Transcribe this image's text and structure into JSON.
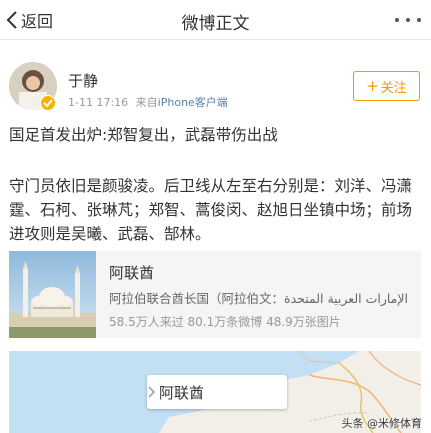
{
  "nav": {
    "back_label": "返回",
    "title": "微博正文",
    "back_icon": "chevron-left-icon",
    "more_icon": "more-dots-icon"
  },
  "user": {
    "name": "于静",
    "timestamp": "1-11 17:16",
    "source_prefix": "来自",
    "source": "iPhone客户端",
    "follow_label": "关注",
    "verified_badge_color": "#f6b400"
  },
  "post": {
    "line1": "国足首发出炉:郑智复出，武磊带伤出战",
    "line2": "守门员依旧是颜骏凌。后卫线从左至右分别是：刘洋、冯潇霆、石柯、张琳芃；郑智、蒿俊闵、赵旭日坐镇中场；前场进攻则是吴曦、武磊、郜林。"
  },
  "location_card": {
    "title": "阿联酋",
    "description": "阿拉伯联合酋长国（阿拉伯文：الإمارات العربية المتحدة",
    "stats": "58.5万人来过 80.1万条微博 48.9万张图片"
  },
  "map": {
    "label": "阿联酋",
    "label_icon": "chevron-right-icon"
  },
  "watermark": "头条 @米修体育",
  "colors": {
    "accent": "#f39800",
    "link": "#5b7fa8",
    "map_water": "#c3dff4",
    "map_land": "#f2efe8"
  }
}
